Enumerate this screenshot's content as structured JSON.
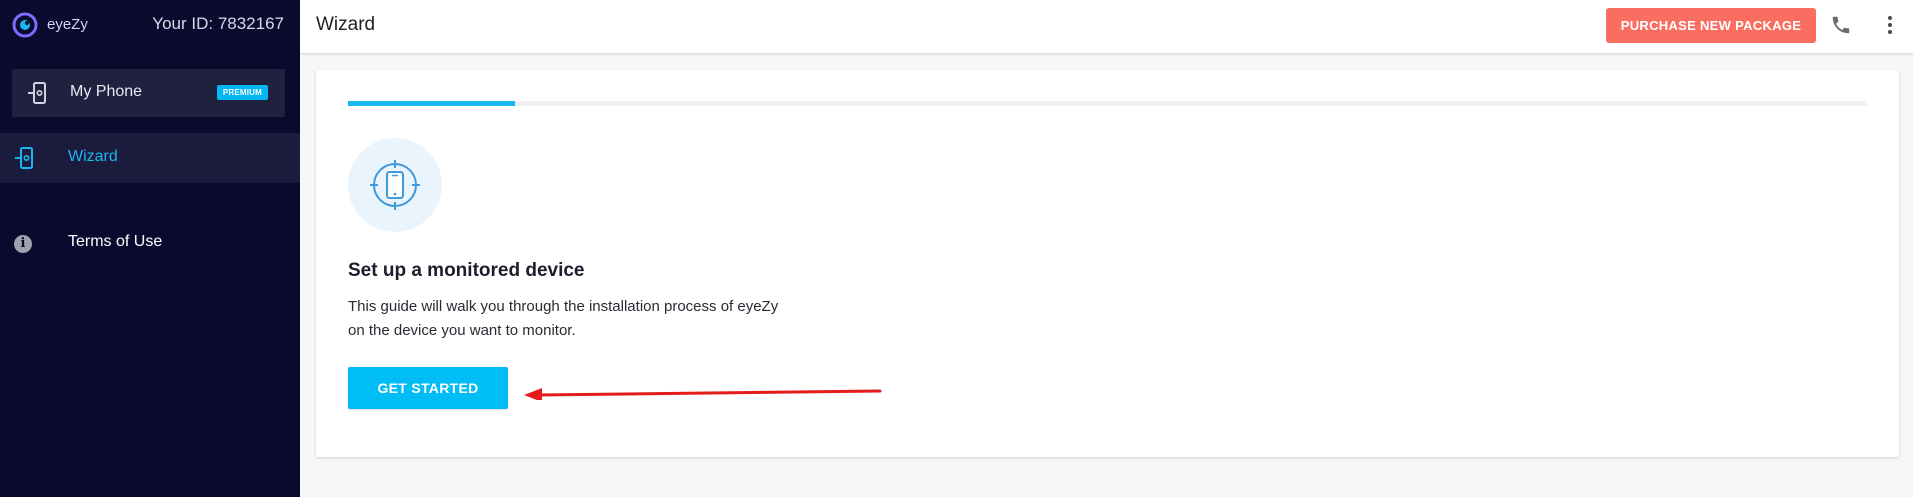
{
  "sidebar": {
    "brand": "eyeZy",
    "your_id": "Your ID: 7832167",
    "device": {
      "label": "My Phone",
      "badge": "PREMIUM"
    },
    "items": [
      {
        "label": "Wizard",
        "icon": "phone-setup-icon",
        "active": true
      },
      {
        "label": "Terms of Use",
        "icon": "info-icon",
        "active": false
      }
    ]
  },
  "topbar": {
    "title": "Wizard",
    "purchase_label": "PURCHASE NEW PACKAGE",
    "icons": [
      "phone-call-icon",
      "more-vert-icon"
    ]
  },
  "main": {
    "progress": 0.11,
    "heading": "Set up a monitored device",
    "description_line1": "This guide will walk you through the installation process of eyeZy",
    "description_line2": "on the device you want to monitor.",
    "button_label": "GET STARTED"
  },
  "colors": {
    "sidebar_bg": "#0a0a2e",
    "accent": "#19b6f0",
    "purchase": "#fa6e62",
    "annotation_arrow": "#e31b1b"
  }
}
